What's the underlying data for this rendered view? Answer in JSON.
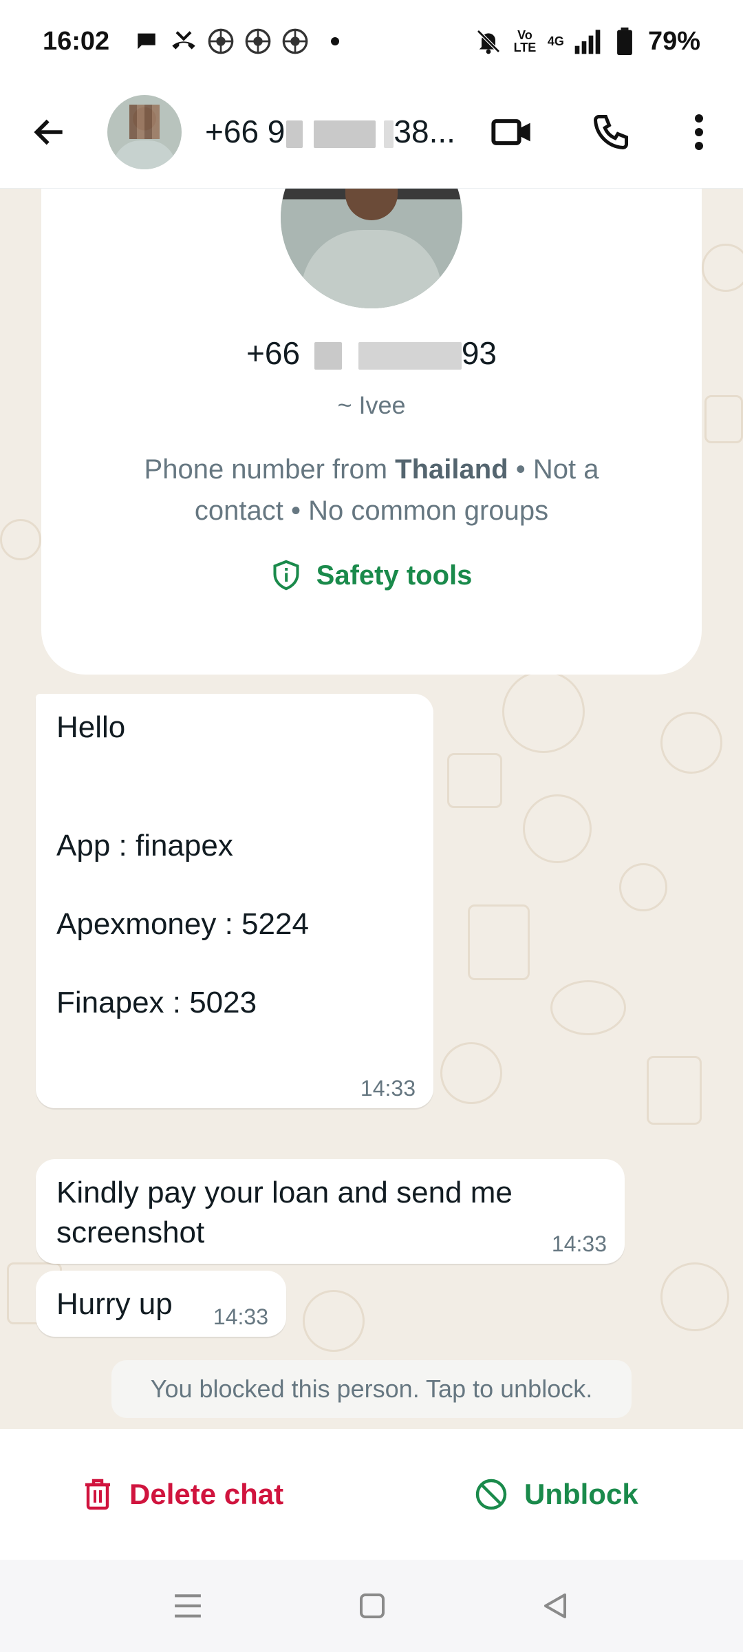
{
  "status_bar": {
    "time": "16:02",
    "battery": "79%",
    "network": "4G",
    "volte": "Vo LTE"
  },
  "header": {
    "title_prefix": "+66 9",
    "title_suffix": "38...",
    "icons": [
      "arrow-back-icon",
      "video-call-icon",
      "voice-call-icon",
      "more-options-icon"
    ]
  },
  "profile": {
    "phone_prefix": "+66",
    "phone_suffix": "93",
    "alias": "~ Ivee",
    "desc_before": "Phone number from ",
    "desc_country": "Thailand",
    "desc_after": " • Not a contact • No common groups",
    "safety_tools": "Safety tools"
  },
  "messages": [
    {
      "lines": [
        "Hello",
        "",
        "",
        "App : finapex",
        "",
        "Apexmoney : 5224",
        "",
        "Finapex : 5023"
      ],
      "time": "14:33"
    },
    {
      "lines": [
        "Kindly pay your loan and send me",
        "screenshot"
      ],
      "time": "14:33"
    },
    {
      "lines": [
        "Hurry up"
      ],
      "time": "14:33"
    }
  ],
  "system_note": "You blocked this person. Tap to unblock.",
  "actions": {
    "delete_chat": "Delete chat",
    "unblock": "Unblock"
  },
  "colors": {
    "chat_bg": "#f2ede5",
    "green": "#1a8a4b",
    "red": "#d0143e"
  }
}
